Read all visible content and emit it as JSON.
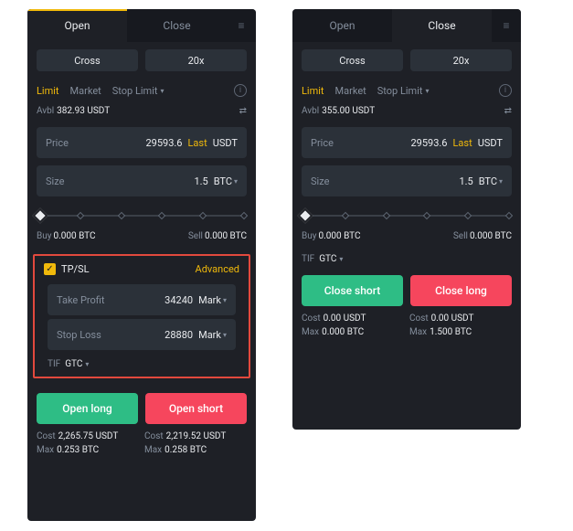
{
  "left": {
    "tabs": {
      "open": "Open",
      "close": "Close"
    },
    "margin_mode": "Cross",
    "leverage": "20x",
    "order_types": {
      "limit": "Limit",
      "market": "Market",
      "stop_limit": "Stop Limit"
    },
    "avbl_label": "Avbl",
    "avbl_value": "382.93 USDT",
    "swap_icon": "⇄",
    "price": {
      "label": "Price",
      "value": "29593.6",
      "last": "Last",
      "unit": "USDT"
    },
    "size": {
      "label": "Size",
      "value": "1.5",
      "unit": "BTC"
    },
    "buy_label": "Buy",
    "buy_value": "0.000 BTC",
    "sell_label": "Sell",
    "sell_value": "0.000 BTC",
    "tpsl": {
      "label": "TP/SL",
      "advanced": "Advanced",
      "tp_label": "Take Profit",
      "tp_value": "34240",
      "tp_unit": "Mark",
      "sl_label": "Stop Loss",
      "sl_value": "28880",
      "sl_unit": "Mark"
    },
    "tif_label": "TIF",
    "tif_value": "GTC",
    "open_long": "Open long",
    "open_short": "Open short",
    "cost_label": "Cost",
    "max_label": "Max",
    "long_cost": "2,265.75 USDT",
    "long_max": "0.253 BTC",
    "short_cost": "2,219.52 USDT",
    "short_max": "0.258 BTC"
  },
  "right": {
    "tabs": {
      "open": "Open",
      "close": "Close"
    },
    "margin_mode": "Cross",
    "leverage": "20x",
    "order_types": {
      "limit": "Limit",
      "market": "Market",
      "stop_limit": "Stop Limit"
    },
    "avbl_label": "Avbl",
    "avbl_value": "355.00 USDT",
    "swap_icon": "⇄",
    "price": {
      "label": "Price",
      "value": "29593.6",
      "last": "Last",
      "unit": "USDT"
    },
    "size": {
      "label": "Size",
      "value": "1.5",
      "unit": "BTC"
    },
    "buy_label": "Buy",
    "buy_value": "0.000 BTC",
    "sell_label": "Sell",
    "sell_value": "0.000 BTC",
    "tif_label": "TIF",
    "tif_value": "GTC",
    "close_short": "Close short",
    "close_long": "Close long",
    "cost_label": "Cost",
    "max_label": "Max",
    "short_cost": "0.00 USDT",
    "short_max": "0.000 BTC",
    "long_cost": "0.00 USDT",
    "long_max": "1.500 BTC"
  }
}
